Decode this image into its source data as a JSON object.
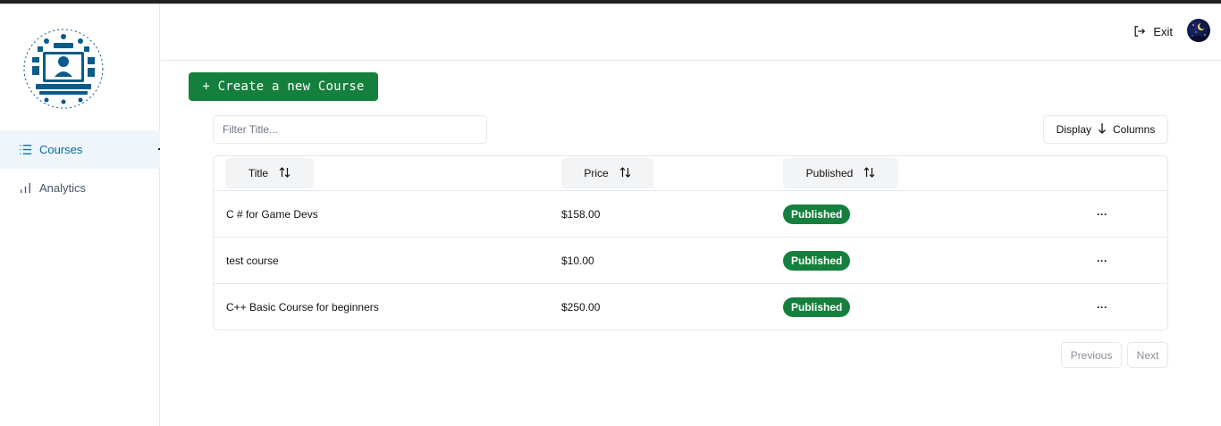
{
  "sidebar": {
    "items": [
      {
        "label": "Courses",
        "icon": "list-icon",
        "active": true
      },
      {
        "label": "Analytics",
        "icon": "bar-chart-icon",
        "active": false
      }
    ]
  },
  "header": {
    "exit_label": "Exit"
  },
  "toolbar": {
    "create_label": "+ Create a new Course",
    "filter_placeholder": "Filter Title...",
    "display_label": "Display",
    "columns_label": "Columns"
  },
  "table": {
    "columns": [
      "Title",
      "Price",
      "Published"
    ],
    "rows": [
      {
        "title": "C # for Game Devs",
        "price": "$158.00",
        "status": "Published",
        "actions": "···"
      },
      {
        "title": "test course",
        "price": "$10.00",
        "status": "Published",
        "actions": "···"
      },
      {
        "title": "C++ Basic Course for beginners",
        "price": "$250.00",
        "status": "Published",
        "actions": "···"
      }
    ]
  },
  "pagination": {
    "previous_label": "Previous",
    "next_label": "Next"
  },
  "colors": {
    "accent": "#15803d",
    "active_nav": "#0369a1",
    "logo": "#0b5a8a"
  }
}
